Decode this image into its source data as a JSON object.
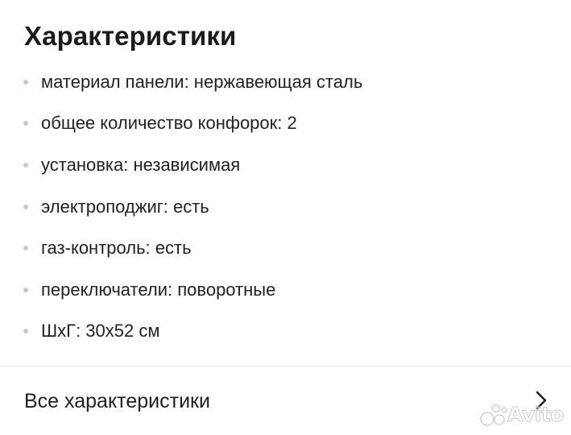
{
  "header": {
    "title": "Характеристики"
  },
  "specs": [
    {
      "text": "материал панели: нержавеющая сталь"
    },
    {
      "text": "общее количество конфорок: 2"
    },
    {
      "text": "установка: независимая"
    },
    {
      "text": "электроподжиг: есть"
    },
    {
      "text": "газ-контроль: есть"
    },
    {
      "text": "переключатели: поворотные"
    },
    {
      "text": "ШхГ: 30x52 см"
    }
  ],
  "footer": {
    "all_specs_label": "Все характеристики",
    "chevron_icon": "chevron-right-icon"
  },
  "watermark": {
    "text": "Avito",
    "icon": "avito-dots-logo"
  },
  "colors": {
    "text": "#222222",
    "bullet": "#c8c8c8",
    "divider": "#e4e4e4",
    "background": "#ffffff"
  }
}
